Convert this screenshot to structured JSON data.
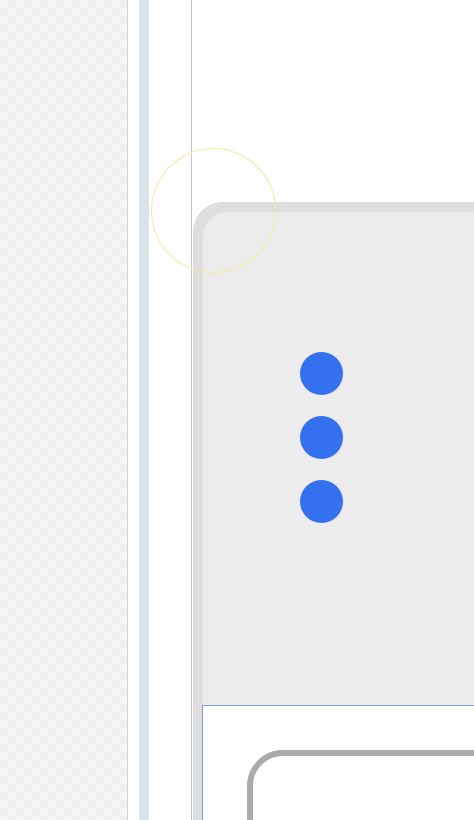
{
  "colors": {
    "accent": "#3570ef",
    "card_background": "#ececec",
    "checker_light": "#f6f6f6",
    "checker_dark": "#efefef",
    "scroll_rail": "#dbe3ea",
    "touch_indicator": "#f2ec9b",
    "selection_border": "#7e9ee8",
    "inner_card_border": "#a9abae"
  },
  "icons": {
    "more_options": "more-vert-icon"
  }
}
